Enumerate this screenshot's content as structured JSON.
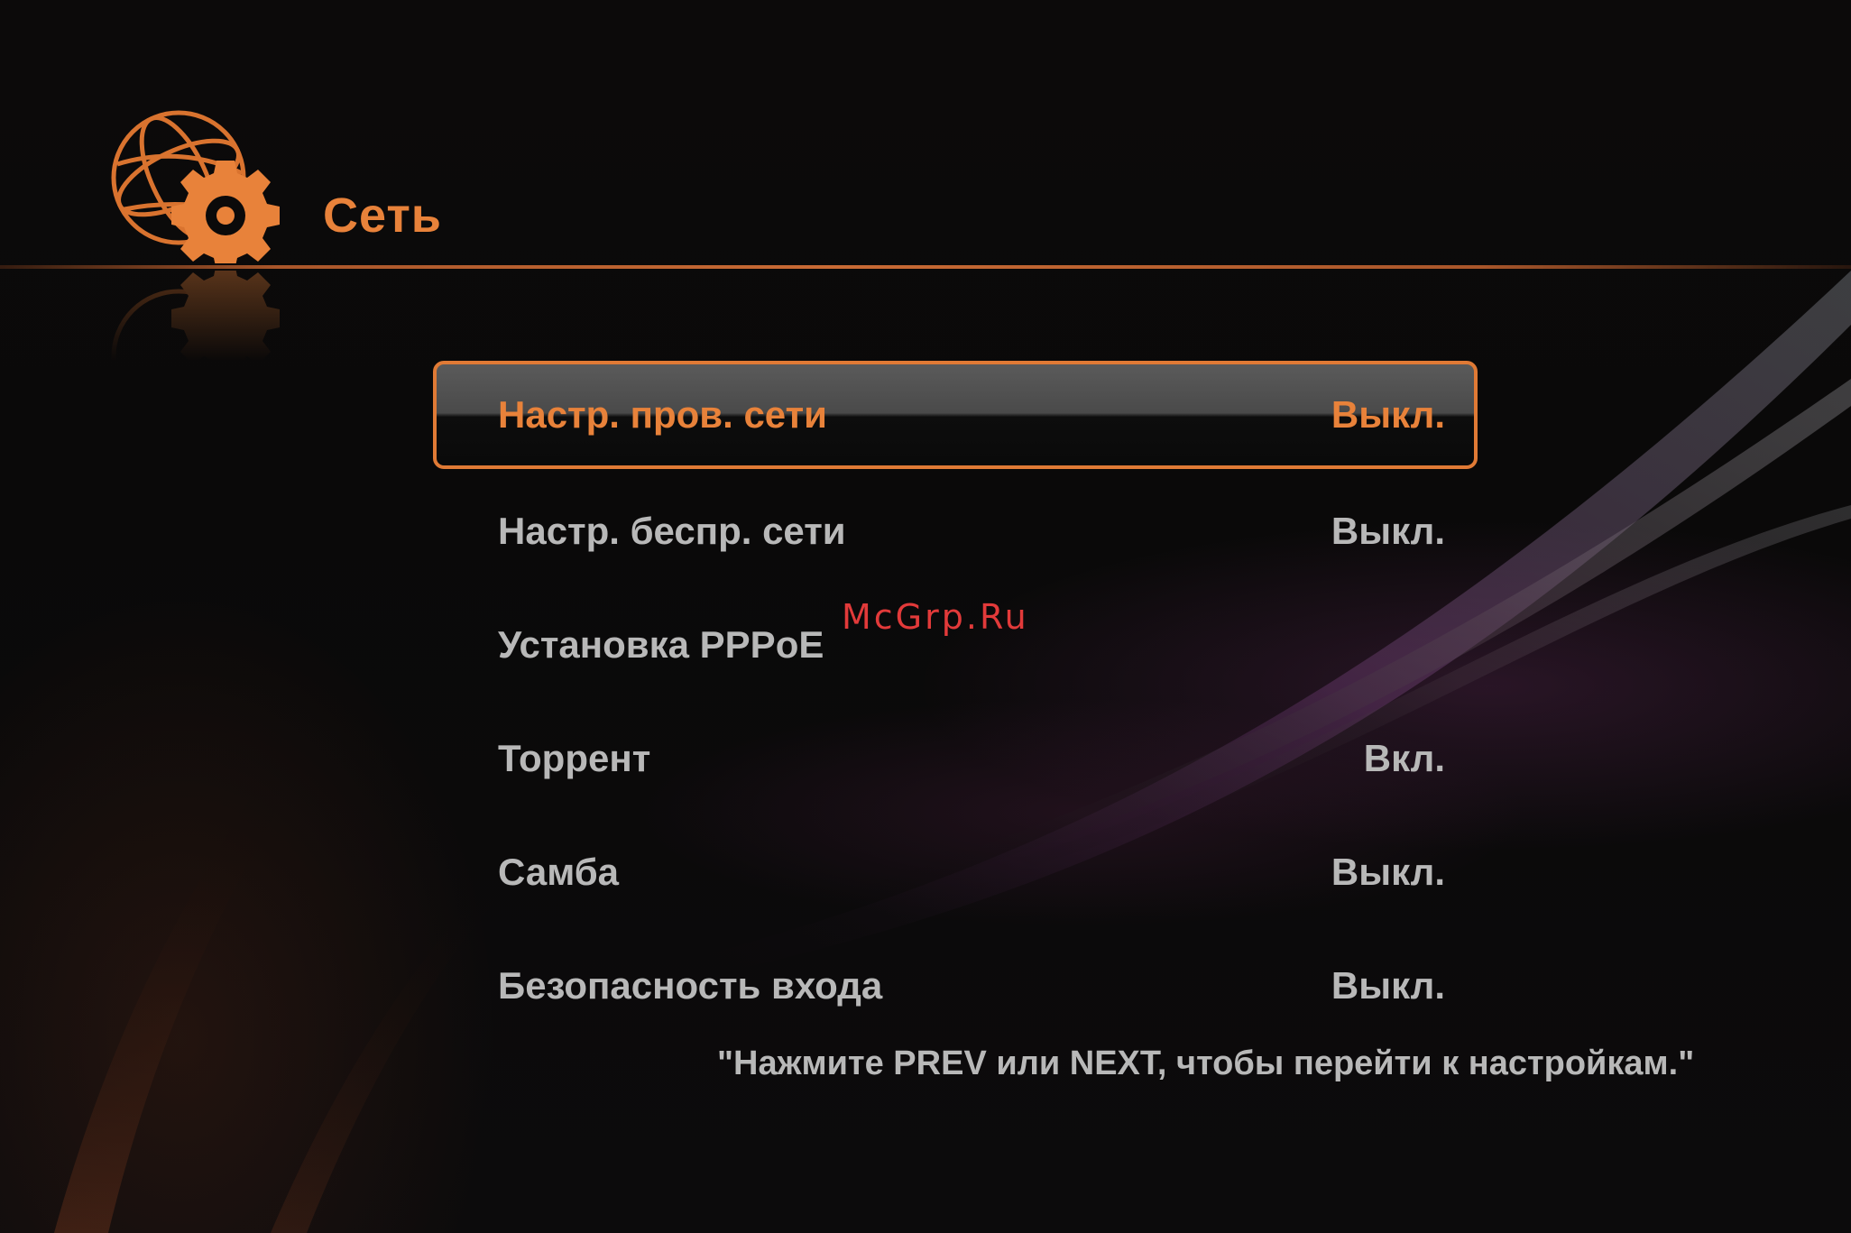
{
  "header": {
    "title": "Сеть",
    "icon": "network-settings-icon"
  },
  "menu": {
    "items": [
      {
        "label": "Настр. пров. сети",
        "value": "Выкл.",
        "selected": true
      },
      {
        "label": "Настр. беспр. сети",
        "value": "Выкл.",
        "selected": false
      },
      {
        "label": "Установка PPPoE",
        "value": "",
        "selected": false
      },
      {
        "label": "Торрент",
        "value": "Вкл.",
        "selected": false
      },
      {
        "label": "Самба",
        "value": "Выкл.",
        "selected": false
      },
      {
        "label": "Безопасность входа",
        "value": "Выкл.",
        "selected": false
      }
    ]
  },
  "hint": "\"Нажмите PREV или NEXT, чтобы перейти к настройкам.\"",
  "watermark": "McGrp.Ru",
  "colors": {
    "accent": "#e8823a",
    "text": "#b8b8b8",
    "background": "#0a0909",
    "watermark": "#e23a3a"
  }
}
